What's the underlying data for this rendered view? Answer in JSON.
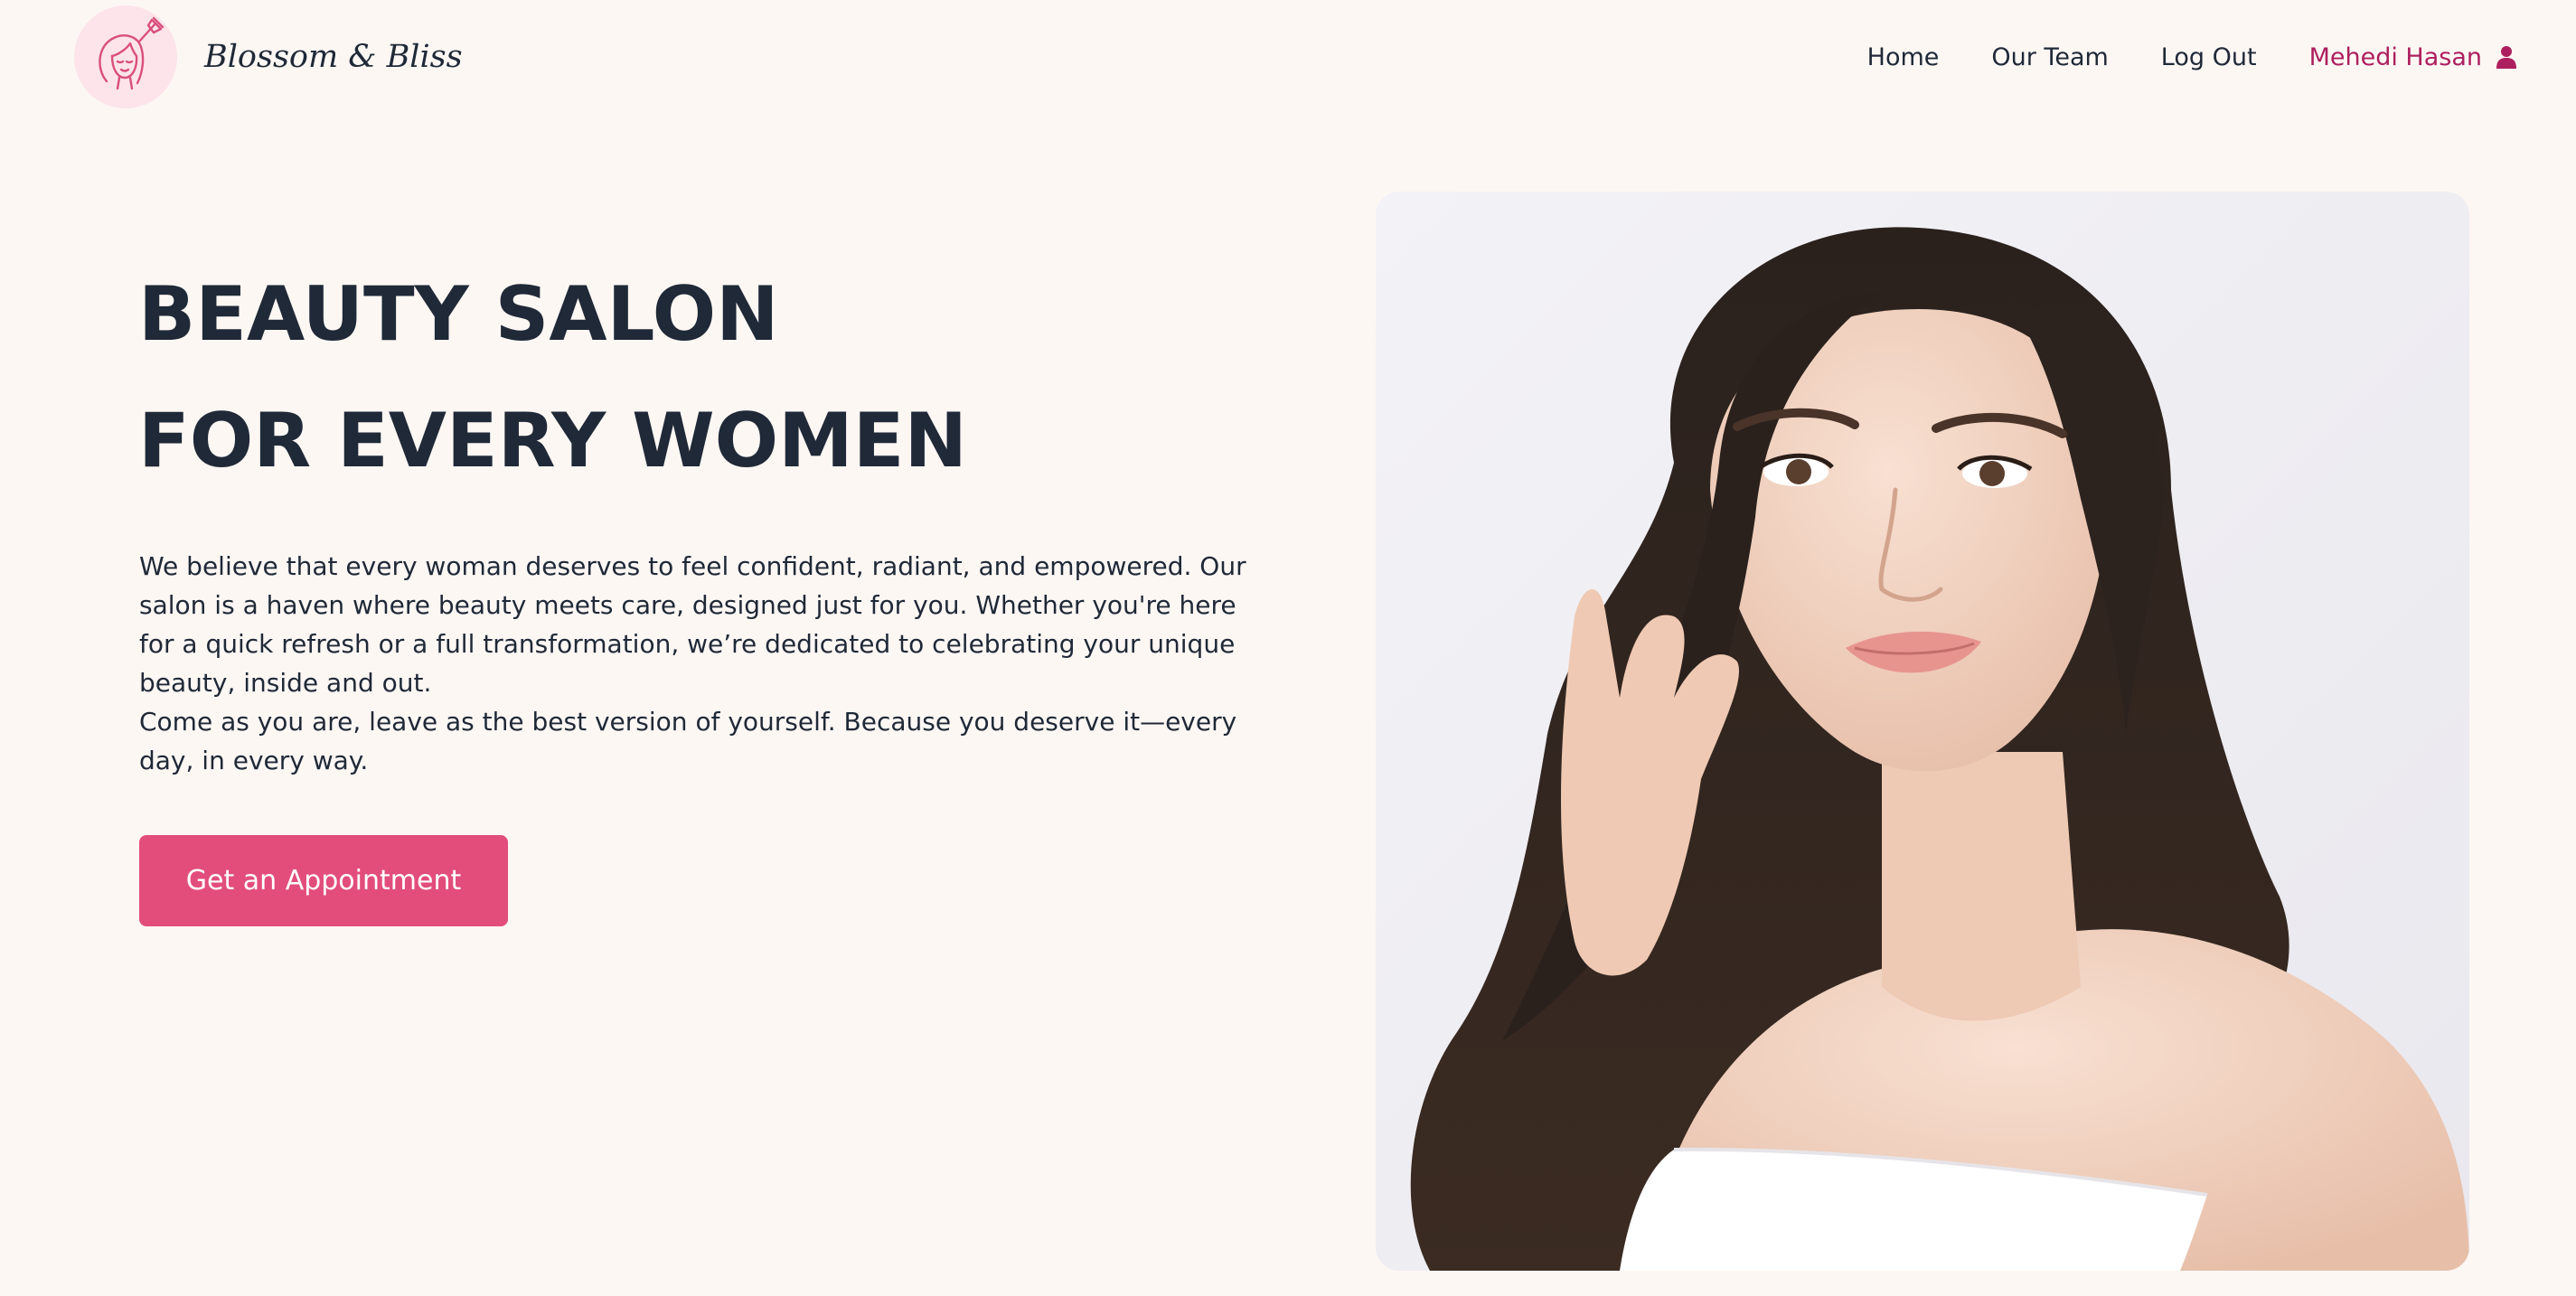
{
  "brand": {
    "name": "Blossom & Bliss",
    "logo_icon": "woman-face-brush-icon",
    "badge_color": "#fce4ea",
    "icon_color": "#d94f7e"
  },
  "nav": {
    "items": [
      {
        "label": "Home"
      },
      {
        "label": "Our Team"
      },
      {
        "label": "Log Out"
      }
    ],
    "user": {
      "name": "Mehedi Hasan",
      "icon": "user-icon",
      "color": "#ad1f5e"
    }
  },
  "hero": {
    "title_line1": "BEAUTY SALON",
    "title_line2": "FOR EVERY WOMEN",
    "paragraph1": "We believe that every woman deserves to feel confident, radiant, and empowered. Our salon is a haven where beauty meets care, designed just for you. Whether you're here for a quick refresh or a full transformation, we’re dedicated to celebrating your unique beauty, inside and out.",
    "paragraph2": "Come as you are, leave as the best version of yourself. Because you deserve it—every day, in every way.",
    "cta_label": "Get an Appointment",
    "cta_color": "#e24d7c"
  },
  "colors": {
    "background": "#fdf7f4",
    "text": "#1f2937"
  }
}
